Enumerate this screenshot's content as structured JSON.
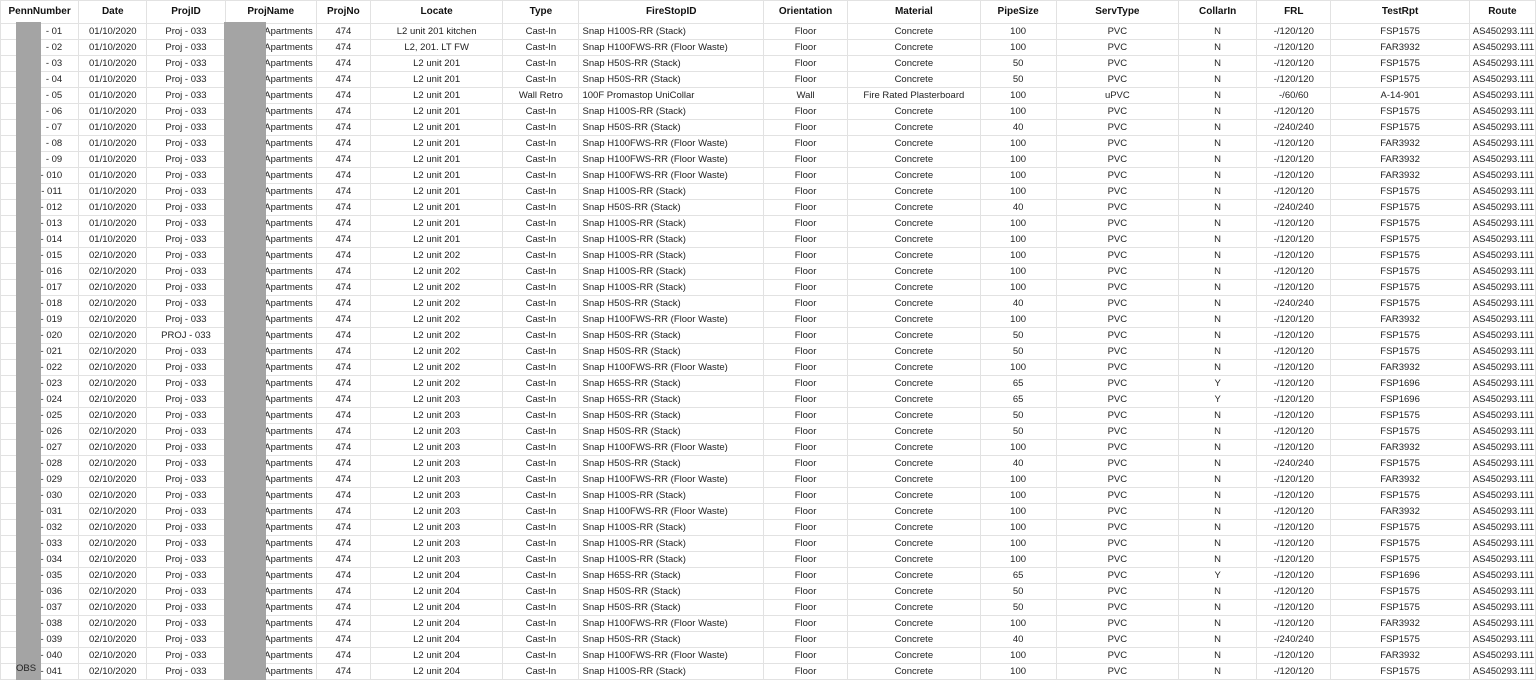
{
  "colors": {
    "grid_line": "#e2e2e2",
    "redaction": "#a4a4a4",
    "text": "#222222"
  },
  "headers": [
    "PennNumber",
    "Date",
    "ProjID",
    "ProjName",
    "ProjNo",
    "Locate",
    "Type",
    "FireStopID",
    "Orientation",
    "Material",
    "PipeSize",
    "ServType",
    "CollarIn",
    "FRL",
    "TestRpt",
    "Route"
  ],
  "rows": [
    {
      "pen": "- 01",
      "date": "01/10/2020",
      "projid": "Proj - 033",
      "projname": "Apartments",
      "projno": "474",
      "locate": "L2 unit 201 kitchen",
      "type": "Cast-In",
      "firestop": "Snap H100S-RR (Stack)",
      "orient": "Floor",
      "material": "Concrete",
      "size": "100",
      "serv": "PVC",
      "collar": "N",
      "frl": "-/120/120",
      "test": "FSP1575",
      "route": "AS450293.111"
    },
    {
      "pen": "- 02",
      "date": "01/10/2020",
      "projid": "Proj - 033",
      "projname": "Apartments",
      "projno": "474",
      "locate": "L2, 201. LT FW",
      "type": "Cast-In",
      "firestop": "Snap H100FWS-RR (Floor Waste)",
      "orient": "Floor",
      "material": "Concrete",
      "size": "100",
      "serv": "PVC",
      "collar": "N",
      "frl": "-/120/120",
      "test": "FAR3932",
      "route": "AS450293.111"
    },
    {
      "pen": "- 03",
      "date": "01/10/2020",
      "projid": "Proj - 033",
      "projname": "Apartments",
      "projno": "474",
      "locate": "L2 unit 201",
      "type": "Cast-In",
      "firestop": "Snap H50S-RR (Stack)",
      "orient": "Floor",
      "material": "Concrete",
      "size": "50",
      "serv": "PVC",
      "collar": "N",
      "frl": "-/120/120",
      "test": "FSP1575",
      "route": "AS450293.111"
    },
    {
      "pen": "- 04",
      "date": "01/10/2020",
      "projid": "Proj - 033",
      "projname": "Apartments",
      "projno": "474",
      "locate": "L2 unit 201",
      "type": "Cast-In",
      "firestop": "Snap H50S-RR (Stack)",
      "orient": "Floor",
      "material": "Concrete",
      "size": "50",
      "serv": "PVC",
      "collar": "N",
      "frl": "-/120/120",
      "test": "FSP1575",
      "route": "AS450293.111"
    },
    {
      "pen": "- 05",
      "date": "01/10/2020",
      "projid": "Proj - 033",
      "projname": "Apartments",
      "projno": "474",
      "locate": "L2 unit 201",
      "type": "Wall Retro",
      "firestop": "100F Promastop UniCollar",
      "orient": "Wall",
      "material": "Fire Rated Plasterboard",
      "size": "100",
      "serv": "uPVC",
      "collar": "N",
      "frl": "-/60/60",
      "test": "A-14-901",
      "route": "AS450293.111"
    },
    {
      "pen": "- 06",
      "date": "01/10/2020",
      "projid": "Proj - 033",
      "projname": "Apartments",
      "projno": "474",
      "locate": "L2 unit 201",
      "type": "Cast-In",
      "firestop": "Snap H100S-RR (Stack)",
      "orient": "Floor",
      "material": "Concrete",
      "size": "100",
      "serv": "PVC",
      "collar": "N",
      "frl": "-/120/120",
      "test": "FSP1575",
      "route": "AS450293.111"
    },
    {
      "pen": "- 07",
      "date": "01/10/2020",
      "projid": "Proj - 033",
      "projname": "Apartments",
      "projno": "474",
      "locate": "L2 unit 201",
      "type": "Cast-In",
      "firestop": "Snap H50S-RR (Stack)",
      "orient": "Floor",
      "material": "Concrete",
      "size": "40",
      "serv": "PVC",
      "collar": "N",
      "frl": "-/240/240",
      "test": "FSP1575",
      "route": "AS450293.111"
    },
    {
      "pen": "- 08",
      "date": "01/10/2020",
      "projid": "Proj - 033",
      "projname": "Apartments",
      "projno": "474",
      "locate": "L2 unit 201",
      "type": "Cast-In",
      "firestop": "Snap H100FWS-RR (Floor Waste)",
      "orient": "Floor",
      "material": "Concrete",
      "size": "100",
      "serv": "PVC",
      "collar": "N",
      "frl": "-/120/120",
      "test": "FAR3932",
      "route": "AS450293.111"
    },
    {
      "pen": "- 09",
      "date": "01/10/2020",
      "projid": "Proj - 033",
      "projname": "Apartments",
      "projno": "474",
      "locate": "L2 unit 201",
      "type": "Cast-In",
      "firestop": "Snap H100FWS-RR (Floor Waste)",
      "orient": "Floor",
      "material": "Concrete",
      "size": "100",
      "serv": "PVC",
      "collar": "N",
      "frl": "-/120/120",
      "test": "FAR3932",
      "route": "AS450293.111"
    },
    {
      "pen": "- 010",
      "date": "01/10/2020",
      "projid": "Proj - 033",
      "projname": "Apartments",
      "projno": "474",
      "locate": "L2 unit 201",
      "type": "Cast-In",
      "firestop": "Snap H100FWS-RR (Floor Waste)",
      "orient": "Floor",
      "material": "Concrete",
      "size": "100",
      "serv": "PVC",
      "collar": "N",
      "frl": "-/120/120",
      "test": "FAR3932",
      "route": "AS450293.111"
    },
    {
      "pen": "- 011",
      "date": "01/10/2020",
      "projid": "Proj - 033",
      "projname": "Apartments",
      "projno": "474",
      "locate": "L2 unit 201",
      "type": "Cast-In",
      "firestop": "Snap H100S-RR (Stack)",
      "orient": "Floor",
      "material": "Concrete",
      "size": "100",
      "serv": "PVC",
      "collar": "N",
      "frl": "-/120/120",
      "test": "FSP1575",
      "route": "AS450293.111"
    },
    {
      "pen": "- 012",
      "date": "01/10/2020",
      "projid": "Proj - 033",
      "projname": "Apartments",
      "projno": "474",
      "locate": "L2 unit 201",
      "type": "Cast-In",
      "firestop": "Snap H50S-RR (Stack)",
      "orient": "Floor",
      "material": "Concrete",
      "size": "40",
      "serv": "PVC",
      "collar": "N",
      "frl": "-/240/240",
      "test": "FSP1575",
      "route": "AS450293.111"
    },
    {
      "pen": "- 013",
      "date": "01/10/2020",
      "projid": "Proj - 033",
      "projname": "Apartments",
      "projno": "474",
      "locate": "L2 unit 201",
      "type": "Cast-In",
      "firestop": "Snap H100S-RR (Stack)",
      "orient": "Floor",
      "material": "Concrete",
      "size": "100",
      "serv": "PVC",
      "collar": "N",
      "frl": "-/120/120",
      "test": "FSP1575",
      "route": "AS450293.111"
    },
    {
      "pen": "- 014",
      "date": "01/10/2020",
      "projid": "Proj - 033",
      "projname": "Apartments",
      "projno": "474",
      "locate": "L2 unit 201",
      "type": "Cast-In",
      "firestop": "Snap H100S-RR (Stack)",
      "orient": "Floor",
      "material": "Concrete",
      "size": "100",
      "serv": "PVC",
      "collar": "N",
      "frl": "-/120/120",
      "test": "FSP1575",
      "route": "AS450293.111"
    },
    {
      "pen": "- 015",
      "date": "02/10/2020",
      "projid": "Proj - 033",
      "projname": "Apartments",
      "projno": "474",
      "locate": "L2 unit 202",
      "type": "Cast-In",
      "firestop": "Snap H100S-RR (Stack)",
      "orient": "Floor",
      "material": "Concrete",
      "size": "100",
      "serv": "PVC",
      "collar": "N",
      "frl": "-/120/120",
      "test": "FSP1575",
      "route": "AS450293.111"
    },
    {
      "pen": "- 016",
      "date": "02/10/2020",
      "projid": "Proj - 033",
      "projname": "Apartments",
      "projno": "474",
      "locate": "L2 unit 202",
      "type": "Cast-In",
      "firestop": "Snap H100S-RR (Stack)",
      "orient": "Floor",
      "material": "Concrete",
      "size": "100",
      "serv": "PVC",
      "collar": "N",
      "frl": "-/120/120",
      "test": "FSP1575",
      "route": "AS450293.111"
    },
    {
      "pen": "- 017",
      "date": "02/10/2020",
      "projid": "Proj - 033",
      "projname": "Apartments",
      "projno": "474",
      "locate": "L2 unit 202",
      "type": "Cast-In",
      "firestop": "Snap H100S-RR (Stack)",
      "orient": "Floor",
      "material": "Concrete",
      "size": "100",
      "serv": "PVC",
      "collar": "N",
      "frl": "-/120/120",
      "test": "FSP1575",
      "route": "AS450293.111"
    },
    {
      "pen": "- 018",
      "date": "02/10/2020",
      "projid": "Proj - 033",
      "projname": "Apartments",
      "projno": "474",
      "locate": "L2 unit 202",
      "type": "Cast-In",
      "firestop": "Snap H50S-RR (Stack)",
      "orient": "Floor",
      "material": "Concrete",
      "size": "40",
      "serv": "PVC",
      "collar": "N",
      "frl": "-/240/240",
      "test": "FSP1575",
      "route": "AS450293.111"
    },
    {
      "pen": "- 019",
      "date": "02/10/2020",
      "projid": "Proj - 033",
      "projname": "Apartments",
      "projno": "474",
      "locate": "L2 unit 202",
      "type": "Cast-In",
      "firestop": "Snap H100FWS-RR (Floor Waste)",
      "orient": "Floor",
      "material": "Concrete",
      "size": "100",
      "serv": "PVC",
      "collar": "N",
      "frl": "-/120/120",
      "test": "FAR3932",
      "route": "AS450293.111"
    },
    {
      "pen": "- 020",
      "date": "02/10/2020",
      "projid": "PROJ - 033",
      "projname": "Apartments",
      "projno": "474",
      "locate": "L2 unit 202",
      "type": "Cast-In",
      "firestop": "Snap H50S-RR (Stack)",
      "orient": "Floor",
      "material": "Concrete",
      "size": "50",
      "serv": "PVC",
      "collar": "N",
      "frl": "-/120/120",
      "test": "FSP1575",
      "route": "AS450293.111"
    },
    {
      "pen": "- 021",
      "date": "02/10/2020",
      "projid": "Proj - 033",
      "projname": "Apartments",
      "projno": "474",
      "locate": "L2 unit 202",
      "type": "Cast-In",
      "firestop": "Snap H50S-RR (Stack)",
      "orient": "Floor",
      "material": "Concrete",
      "size": "50",
      "serv": "PVC",
      "collar": "N",
      "frl": "-/120/120",
      "test": "FSP1575",
      "route": "AS450293.111"
    },
    {
      "pen": "- 022",
      "date": "02/10/2020",
      "projid": "Proj - 033",
      "projname": "Apartments",
      "projno": "474",
      "locate": "L2 unit 202",
      "type": "Cast-In",
      "firestop": "Snap H100FWS-RR (Floor Waste)",
      "orient": "Floor",
      "material": "Concrete",
      "size": "100",
      "serv": "PVC",
      "collar": "N",
      "frl": "-/120/120",
      "test": "FAR3932",
      "route": "AS450293.111"
    },
    {
      "pen": "- 023",
      "date": "02/10/2020",
      "projid": "Proj - 033",
      "projname": "Apartments",
      "projno": "474",
      "locate": "L2 unit 202",
      "type": "Cast-In",
      "firestop": "Snap H65S-RR (Stack)",
      "orient": "Floor",
      "material": "Concrete",
      "size": "65",
      "serv": "PVC",
      "collar": "Y",
      "frl": "-/120/120",
      "test": "FSP1696",
      "route": "AS450293.111"
    },
    {
      "pen": "- 024",
      "date": "02/10/2020",
      "projid": "Proj - 033",
      "projname": "Apartments",
      "projno": "474",
      "locate": "L2 unit 203",
      "type": "Cast-In",
      "firestop": "Snap H65S-RR (Stack)",
      "orient": "Floor",
      "material": "Concrete",
      "size": "65",
      "serv": "PVC",
      "collar": "Y",
      "frl": "-/120/120",
      "test": "FSP1696",
      "route": "AS450293.111"
    },
    {
      "pen": "- 025",
      "date": "02/10/2020",
      "projid": "Proj - 033",
      "projname": "Apartments",
      "projno": "474",
      "locate": "L2 unit 203",
      "type": "Cast-In",
      "firestop": "Snap H50S-RR (Stack)",
      "orient": "Floor",
      "material": "Concrete",
      "size": "50",
      "serv": "PVC",
      "collar": "N",
      "frl": "-/120/120",
      "test": "FSP1575",
      "route": "AS450293.111"
    },
    {
      "pen": "- 026",
      "date": "02/10/2020",
      "projid": "Proj - 033",
      "projname": "Apartments",
      "projno": "474",
      "locate": "L2 unit 203",
      "type": "Cast-In",
      "firestop": "Snap H50S-RR (Stack)",
      "orient": "Floor",
      "material": "Concrete",
      "size": "50",
      "serv": "PVC",
      "collar": "N",
      "frl": "-/120/120",
      "test": "FSP1575",
      "route": "AS450293.111"
    },
    {
      "pen": "- 027",
      "date": "02/10/2020",
      "projid": "Proj - 033",
      "projname": "Apartments",
      "projno": "474",
      "locate": "L2 unit 203",
      "type": "Cast-In",
      "firestop": "Snap H100FWS-RR (Floor Waste)",
      "orient": "Floor",
      "material": "Concrete",
      "size": "100",
      "serv": "PVC",
      "collar": "N",
      "frl": "-/120/120",
      "test": "FAR3932",
      "route": "AS450293.111"
    },
    {
      "pen": "- 028",
      "date": "02/10/2020",
      "projid": "Proj - 033",
      "projname": "Apartments",
      "projno": "474",
      "locate": "L2 unit 203",
      "type": "Cast-In",
      "firestop": "Snap H50S-RR (Stack)",
      "orient": "Floor",
      "material": "Concrete",
      "size": "40",
      "serv": "PVC",
      "collar": "N",
      "frl": "-/240/240",
      "test": "FSP1575",
      "route": "AS450293.111"
    },
    {
      "pen": "- 029",
      "date": "02/10/2020",
      "projid": "Proj - 033",
      "projname": "Apartments",
      "projno": "474",
      "locate": "L2 unit 203",
      "type": "Cast-In",
      "firestop": "Snap H100FWS-RR (Floor Waste)",
      "orient": "Floor",
      "material": "Concrete",
      "size": "100",
      "serv": "PVC",
      "collar": "N",
      "frl": "-/120/120",
      "test": "FAR3932",
      "route": "AS450293.111"
    },
    {
      "pen": "- 030",
      "date": "02/10/2020",
      "projid": "Proj - 033",
      "projname": "Apartments",
      "projno": "474",
      "locate": "L2 unit 203",
      "type": "Cast-In",
      "firestop": "Snap H100S-RR (Stack)",
      "orient": "Floor",
      "material": "Concrete",
      "size": "100",
      "serv": "PVC",
      "collar": "N",
      "frl": "-/120/120",
      "test": "FSP1575",
      "route": "AS450293.111"
    },
    {
      "pen": "- 031",
      "date": "02/10/2020",
      "projid": "Proj - 033",
      "projname": "Apartments",
      "projno": "474",
      "locate": "L2 unit 203",
      "type": "Cast-In",
      "firestop": "Snap H100FWS-RR (Floor Waste)",
      "orient": "Floor",
      "material": "Concrete",
      "size": "100",
      "serv": "PVC",
      "collar": "N",
      "frl": "-/120/120",
      "test": "FAR3932",
      "route": "AS450293.111"
    },
    {
      "pen": "- 032",
      "date": "02/10/2020",
      "projid": "Proj - 033",
      "projname": "Apartments",
      "projno": "474",
      "locate": "L2 unit 203",
      "type": "Cast-In",
      "firestop": "Snap H100S-RR (Stack)",
      "orient": "Floor",
      "material": "Concrete",
      "size": "100",
      "serv": "PVC",
      "collar": "N",
      "frl": "-/120/120",
      "test": "FSP1575",
      "route": "AS450293.111"
    },
    {
      "pen": "- 033",
      "date": "02/10/2020",
      "projid": "Proj - 033",
      "projname": "Apartments",
      "projno": "474",
      "locate": "L2 unit 203",
      "type": "Cast-In",
      "firestop": "Snap H100S-RR (Stack)",
      "orient": "Floor",
      "material": "Concrete",
      "size": "100",
      "serv": "PVC",
      "collar": "N",
      "frl": "-/120/120",
      "test": "FSP1575",
      "route": "AS450293.111"
    },
    {
      "pen": "- 034",
      "date": "02/10/2020",
      "projid": "Proj - 033",
      "projname": "Apartments",
      "projno": "474",
      "locate": "L2 unit 203",
      "type": "Cast-In",
      "firestop": "Snap H100S-RR (Stack)",
      "orient": "Floor",
      "material": "Concrete",
      "size": "100",
      "serv": "PVC",
      "collar": "N",
      "frl": "-/120/120",
      "test": "FSP1575",
      "route": "AS450293.111"
    },
    {
      "pen": "- 035",
      "date": "02/10/2020",
      "projid": "Proj - 033",
      "projname": "Apartments",
      "projno": "474",
      "locate": "L2 unit 204",
      "type": "Cast-In",
      "firestop": "Snap H65S-RR (Stack)",
      "orient": "Floor",
      "material": "Concrete",
      "size": "65",
      "serv": "PVC",
      "collar": "Y",
      "frl": "-/120/120",
      "test": "FSP1696",
      "route": "AS450293.111"
    },
    {
      "pen": "- 036",
      "date": "02/10/2020",
      "projid": "Proj - 033",
      "projname": "Apartments",
      "projno": "474",
      "locate": "L2 unit 204",
      "type": "Cast-In",
      "firestop": "Snap H50S-RR (Stack)",
      "orient": "Floor",
      "material": "Concrete",
      "size": "50",
      "serv": "PVC",
      "collar": "N",
      "frl": "-/120/120",
      "test": "FSP1575",
      "route": "AS450293.111"
    },
    {
      "pen": "- 037",
      "date": "02/10/2020",
      "projid": "Proj - 033",
      "projname": "Apartments",
      "projno": "474",
      "locate": "L2 unit 204",
      "type": "Cast-In",
      "firestop": "Snap H50S-RR (Stack)",
      "orient": "Floor",
      "material": "Concrete",
      "size": "50",
      "serv": "PVC",
      "collar": "N",
      "frl": "-/120/120",
      "test": "FSP1575",
      "route": "AS450293.111"
    },
    {
      "pen": "- 038",
      "date": "02/10/2020",
      "projid": "Proj - 033",
      "projname": "Apartments",
      "projno": "474",
      "locate": "L2 unit 204",
      "type": "Cast-In",
      "firestop": "Snap H100FWS-RR (Floor Waste)",
      "orient": "Floor",
      "material": "Concrete",
      "size": "100",
      "serv": "PVC",
      "collar": "N",
      "frl": "-/120/120",
      "test": "FAR3932",
      "route": "AS450293.111"
    },
    {
      "pen": "- 039",
      "date": "02/10/2020",
      "projid": "Proj - 033",
      "projname": "Apartments",
      "projno": "474",
      "locate": "L2 unit 204",
      "type": "Cast-In",
      "firestop": "Snap H50S-RR (Stack)",
      "orient": "Floor",
      "material": "Concrete",
      "size": "40",
      "serv": "PVC",
      "collar": "N",
      "frl": "-/240/240",
      "test": "FSP1575",
      "route": "AS450293.111"
    },
    {
      "pen": "- 040",
      "date": "02/10/2020",
      "projid": "Proj - 033",
      "projname": "Apartments",
      "projno": "474",
      "locate": "L2 unit 204",
      "type": "Cast-In",
      "firestop": "Snap H100FWS-RR (Floor Waste)",
      "orient": "Floor",
      "material": "Concrete",
      "size": "100",
      "serv": "PVC",
      "collar": "N",
      "frl": "-/120/120",
      "test": "FAR3932",
      "route": "AS450293.111"
    },
    {
      "pen": "- 041",
      "date": "02/10/2020",
      "projid": "Proj - 033",
      "projname": "Apartments",
      "projno": "474",
      "locate": "L2 unit 204",
      "type": "Cast-In",
      "firestop": "Snap H100S-RR (Stack)",
      "orient": "Floor",
      "material": "Concrete",
      "size": "100",
      "serv": "PVC",
      "collar": "N",
      "frl": "-/120/120",
      "test": "FSP1575",
      "route": "AS450293.111"
    }
  ],
  "partial_prefix": "OBS"
}
